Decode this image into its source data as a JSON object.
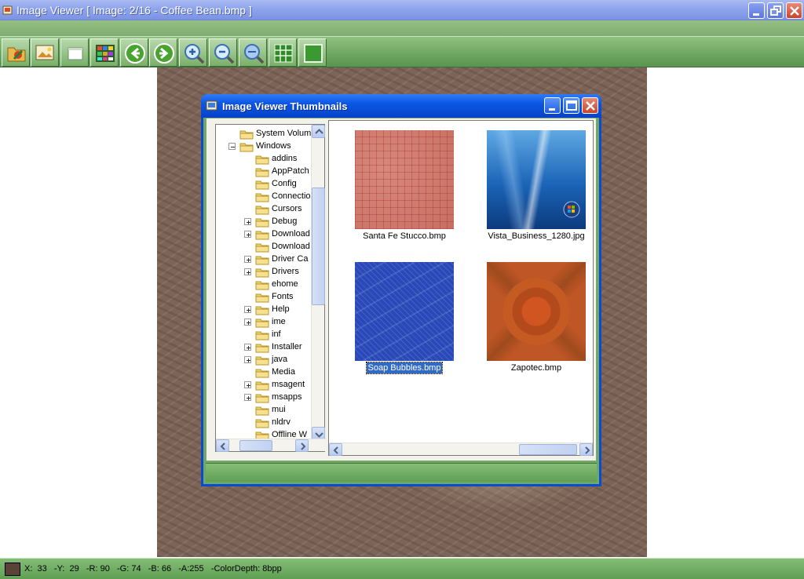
{
  "window": {
    "title": "Image Viewer [ Image: 2/16 - Coffee Bean.bmp ]",
    "buttons": {
      "minimize": "minimize",
      "restore": "restore",
      "close": "close"
    }
  },
  "toolbar": {
    "buttons": [
      {
        "name": "open-folder-icon"
      },
      {
        "name": "open-image-icon"
      },
      {
        "name": "fit-window-icon"
      },
      {
        "name": "thumbnails-icon"
      },
      {
        "name": "previous-image-icon"
      },
      {
        "name": "next-image-icon"
      },
      {
        "name": "zoom-in-icon"
      },
      {
        "name": "zoom-out-icon"
      },
      {
        "name": "zoom-reset-icon"
      },
      {
        "name": "tile-view-icon"
      },
      {
        "name": "full-view-icon"
      }
    ]
  },
  "thumbnails_dialog": {
    "title": "Image Viewer Thumbnails",
    "tree": [
      {
        "label": "System Volum",
        "level": 1,
        "expander": "none"
      },
      {
        "label": "Windows",
        "level": 1,
        "expander": "minus"
      },
      {
        "label": "addins",
        "level": 2,
        "expander": "none"
      },
      {
        "label": "AppPatch",
        "level": 2,
        "expander": "none"
      },
      {
        "label": "Config",
        "level": 2,
        "expander": "none"
      },
      {
        "label": "Connectio",
        "level": 2,
        "expander": "none"
      },
      {
        "label": "Cursors",
        "level": 2,
        "expander": "none"
      },
      {
        "label": "Debug",
        "level": 2,
        "expander": "plus"
      },
      {
        "label": "Download",
        "level": 2,
        "expander": "plus"
      },
      {
        "label": "Download",
        "level": 2,
        "expander": "none"
      },
      {
        "label": "Driver Ca",
        "level": 2,
        "expander": "plus"
      },
      {
        "label": "Drivers",
        "level": 2,
        "expander": "plus"
      },
      {
        "label": "ehome",
        "level": 2,
        "expander": "none"
      },
      {
        "label": "Fonts",
        "level": 2,
        "expander": "none"
      },
      {
        "label": "Help",
        "level": 2,
        "expander": "plus"
      },
      {
        "label": "ime",
        "level": 2,
        "expander": "plus"
      },
      {
        "label": "inf",
        "level": 2,
        "expander": "none"
      },
      {
        "label": "Installer",
        "level": 2,
        "expander": "plus"
      },
      {
        "label": "java",
        "level": 2,
        "expander": "plus"
      },
      {
        "label": "Media",
        "level": 2,
        "expander": "none"
      },
      {
        "label": "msagent",
        "level": 2,
        "expander": "plus"
      },
      {
        "label": "msapps",
        "level": 2,
        "expander": "plus"
      },
      {
        "label": "mui",
        "level": 2,
        "expander": "none"
      },
      {
        "label": "nldrv",
        "level": 2,
        "expander": "none"
      },
      {
        "label": "Offline W",
        "level": 2,
        "expander": "none"
      }
    ],
    "thumbnails": [
      {
        "caption": "Santa Fe Stucco.bmp",
        "selected": false
      },
      {
        "caption": "Vista_Business_1280.jpg",
        "selected": false
      },
      {
        "caption": "Soap Bubbles.bmp",
        "selected": true
      },
      {
        "caption": "Zapotec.bmp",
        "selected": false
      }
    ]
  },
  "status": {
    "swatch_color": "#5a4236",
    "text": "X:  33   -Y:  29   -R: 90   -G: 74   -B: 66   -A:255   -ColorDepth: 8bpp"
  },
  "colors": {
    "toolbar_green": "#6fa862",
    "dialog_titlebar": "#0b56e4",
    "selection_blue": "#316ac5"
  }
}
